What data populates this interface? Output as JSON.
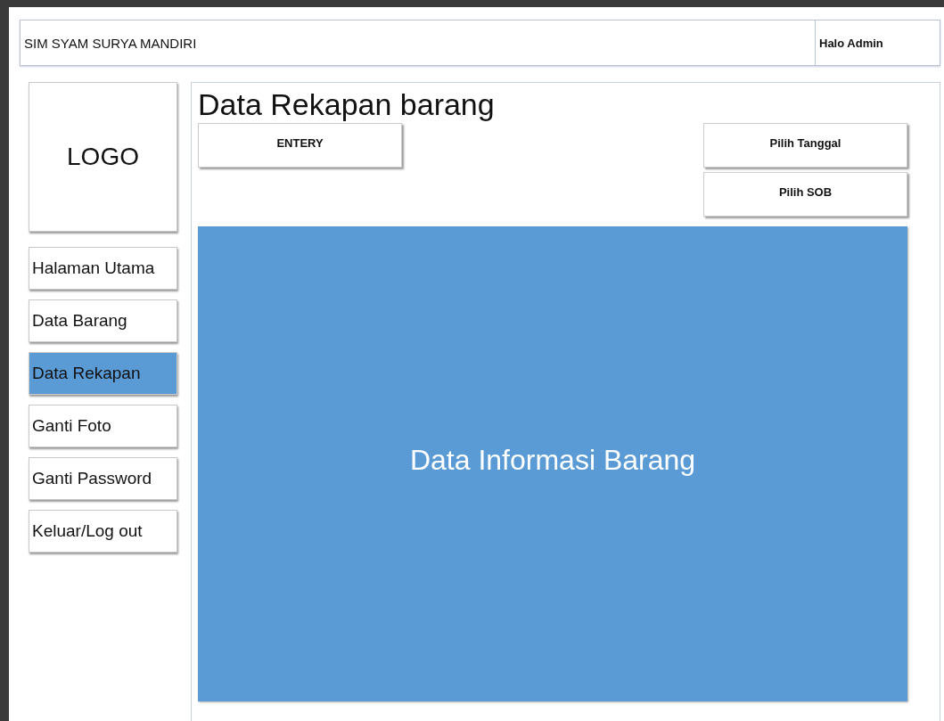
{
  "header": {
    "title": "SIM SYAM SURYA MANDIRI",
    "greeting": "Halo Admin"
  },
  "sidebar": {
    "logo": "LOGO",
    "items": [
      {
        "label": "Halaman Utama",
        "selected": false
      },
      {
        "label": "Data Barang",
        "selected": false
      },
      {
        "label": "Data Rekapan",
        "selected": true
      },
      {
        "label": "Ganti Foto",
        "selected": false
      },
      {
        "label": "Ganti Password",
        "selected": false
      },
      {
        "label": "Keluar/Log out",
        "selected": false
      }
    ]
  },
  "main": {
    "title": "Data Rekapan barang",
    "entry_button": "ENTERY",
    "filter_buttons": [
      "Pilih Tanggal",
      "Pilih SOB"
    ],
    "content_label": "Data Informasi Barang"
  }
}
